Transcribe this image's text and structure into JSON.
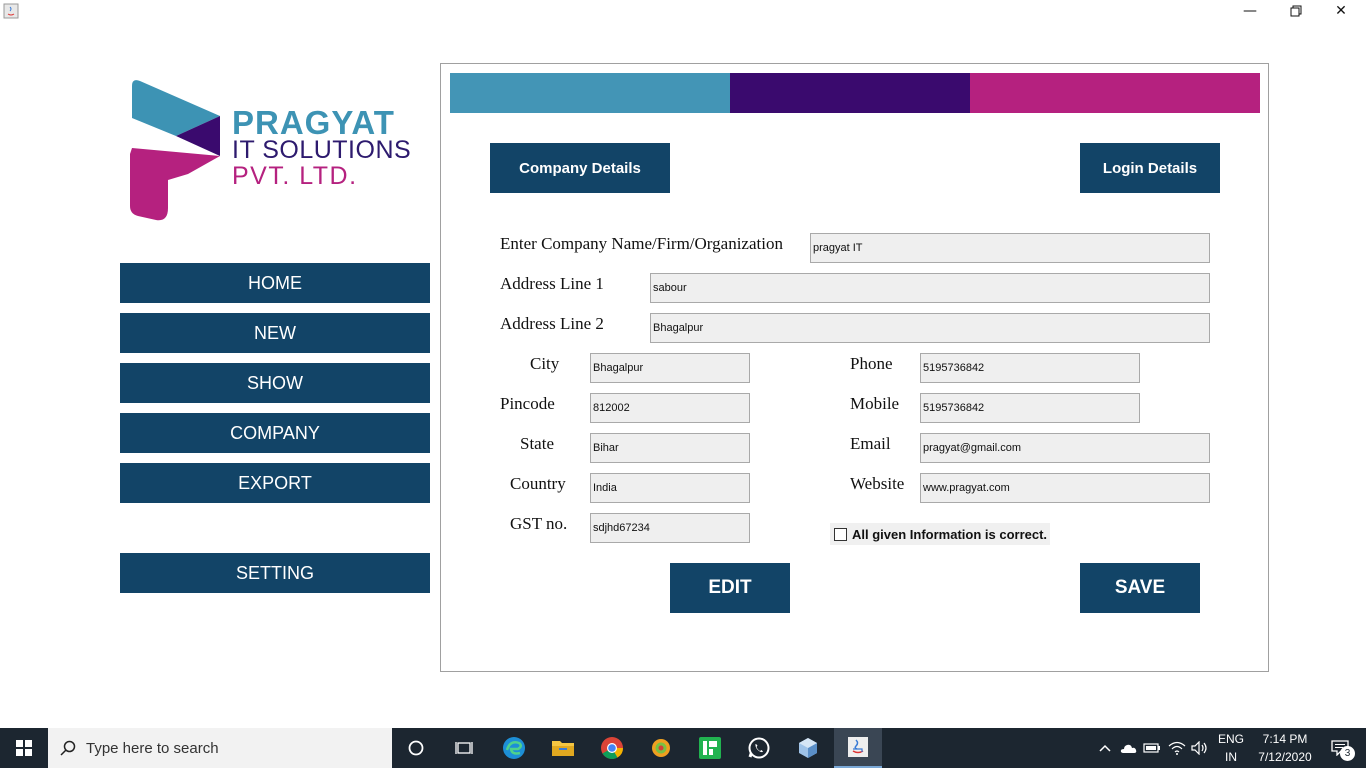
{
  "window": {
    "minimize_icon": "minimize-icon",
    "maximize_icon": "restore-icon",
    "close_icon": "close-icon"
  },
  "logo": {
    "line1": "PRAGYAT",
    "line2": "IT SOLUTIONS",
    "line3": "PVT. LTD.",
    "colors": {
      "teal": "#3d93b4",
      "purple": "#3a0a6e",
      "magenta": "#b5217f"
    }
  },
  "sidebar": {
    "home": "HOME",
    "new": "NEW",
    "show": "SHOW",
    "company": "COMPANY",
    "export": "EXPORT",
    "setting": "SETTING"
  },
  "panel": {
    "bar_colors": [
      "#4395b6",
      "#3a0a6e",
      "#b5217f"
    ],
    "tabs": {
      "company": "Company Details",
      "login": "Login Details"
    },
    "labels": {
      "company_name": "Enter Company Name/Firm/Organization",
      "address1": "Address Line 1",
      "address2": "Address Line 2",
      "city": "City",
      "pincode": "Pincode",
      "state": "State",
      "country": "Country",
      "gst": "GST no.",
      "phone": "Phone",
      "mobile": "Mobile",
      "email": "Email",
      "website": "Website"
    },
    "values": {
      "company_name": "pragyat IT",
      "address1": "sabour",
      "address2": "Bhagalpur",
      "city": "Bhagalpur",
      "pincode": "812002",
      "state": "Bihar",
      "country": "India",
      "gst": "sdjhd67234",
      "phone": "5195736842",
      "mobile": "5195736842",
      "email": "pragyat@gmail.com",
      "website": "www.pragyat.com"
    },
    "confirm_label": "All given Information is correct.",
    "confirm_checked": false,
    "edit": "EDIT",
    "save": "SAVE",
    "accent": "#124467"
  },
  "taskbar": {
    "search_placeholder": "Type here to search",
    "lang_top": "ENG",
    "lang_bottom": "IN",
    "time": "7:14 PM",
    "date": "7/12/2020",
    "notifications": "3"
  }
}
